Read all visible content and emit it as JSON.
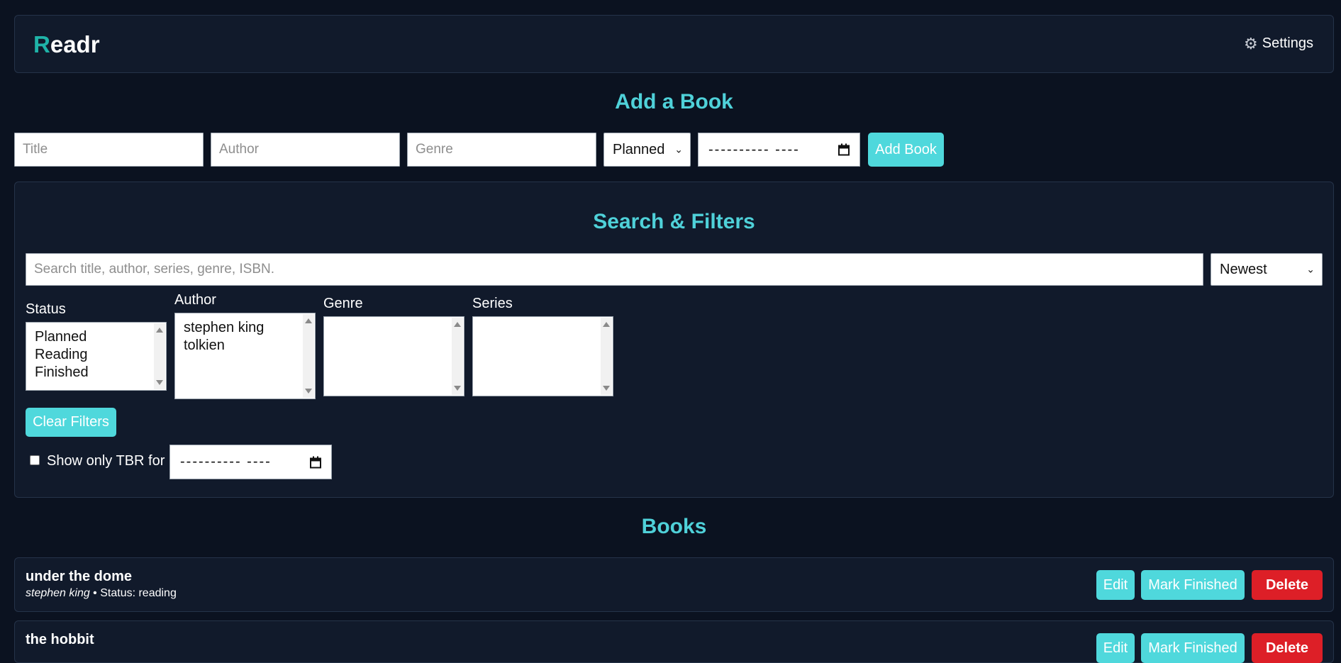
{
  "app": {
    "logo_mark": "R",
    "logo_rest": "eadr",
    "settings_label": "Settings"
  },
  "add_book": {
    "heading": "Add a Book",
    "title_placeholder": "Title",
    "author_placeholder": "Author",
    "genre_placeholder": "Genre",
    "status_value": "Planned",
    "date_value": "---------- ----",
    "add_button": "Add Book"
  },
  "filters": {
    "heading": "Search & Filters",
    "search_placeholder": "Search title, author, series, genre, ISBN.",
    "sort_value": "Newest",
    "status_label": "Status",
    "status_options": [
      "Planned",
      "Reading",
      "Finished"
    ],
    "author_label": "Author",
    "author_options": [
      "stephen king",
      "tolkien"
    ],
    "genre_label": "Genre",
    "series_label": "Series",
    "clear_button": "Clear Filters",
    "tbr_label": "Show only TBR for",
    "tbr_date_value": "---------- ----"
  },
  "books": {
    "heading": "Books",
    "items": [
      {
        "title": "under the dome",
        "author": "stephen king",
        "status_text": " • Status: reading",
        "edit": "Edit",
        "mark_finished": "Mark Finished",
        "delete": "Delete"
      },
      {
        "title": "the hobbit",
        "edit": "Edit",
        "mark_finished": "Mark Finished",
        "delete": "Delete"
      }
    ]
  }
}
